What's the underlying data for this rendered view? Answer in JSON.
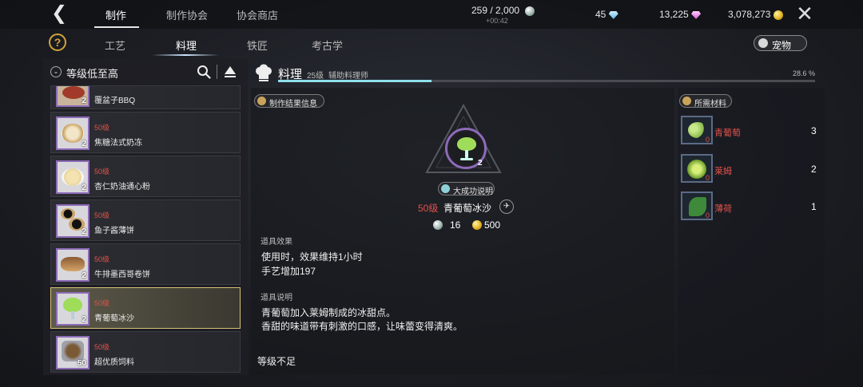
{
  "top_nav": {
    "tabs": [
      "制作",
      "制作协会",
      "协会商店"
    ],
    "active_tab": "制作",
    "stamina": "259 / 2,000",
    "stamina_timer": "+00:42",
    "currencies": [
      {
        "value": "45",
        "icon": "blue-gem-icon"
      },
      {
        "value": "13,225",
        "icon": "pink-gem-icon"
      },
      {
        "value": "3,078,273",
        "icon": "gold-coin-icon"
      }
    ]
  },
  "sub_nav": {
    "tabs": [
      "工艺",
      "料理",
      "铁匠",
      "考古学"
    ],
    "active_tab": "料理",
    "pet_label": "宠物"
  },
  "sort": {
    "label": "等级低至高"
  },
  "recipes": [
    {
      "level": "",
      "name": "覆盆子BBQ",
      "qty": "2"
    },
    {
      "level": "50级",
      "name": "焦糖法式奶冻",
      "qty": "2"
    },
    {
      "level": "50级",
      "name": "杏仁奶油通心粉",
      "qty": "2"
    },
    {
      "level": "50级",
      "name": "鱼子酱薄饼",
      "qty": "2"
    },
    {
      "level": "50级",
      "name": "牛排墨西哥卷饼",
      "qty": "2"
    },
    {
      "level": "50级",
      "name": "青葡萄冰沙",
      "qty": "2"
    },
    {
      "level": "50级",
      "name": "超优质饲料",
      "qty": "50"
    }
  ],
  "selected_recipe_index": 5,
  "profession": {
    "title": "料理",
    "level": "25级",
    "rank": "辅助料理师",
    "progress_percent": 28.6,
    "progress_label": "28.6 %"
  },
  "result": {
    "section_label": "制作结果信息",
    "success_label": "大成功说明",
    "level": "50级",
    "name": "青葡萄冰沙",
    "qty": "2",
    "cost_silver": "16",
    "cost_gold": "500",
    "effect_label": "道具效果",
    "effect_lines": [
      "使用时，效果维持1小时",
      "手艺增加197"
    ],
    "desc_label": "道具说明",
    "desc_lines": [
      "青葡萄加入莱姆制成的冰甜点。",
      "香甜的味道带有刺激的口感，让味蕾变得清爽。"
    ],
    "status": "等级不足"
  },
  "materials": {
    "section_label": "所需材料",
    "items": [
      {
        "name": "青葡萄",
        "owned": "0",
        "required": "3",
        "icon": "green-grapes-icon"
      },
      {
        "name": "莱姆",
        "owned": "0",
        "required": "2",
        "icon": "lime-icon"
      },
      {
        "name": "薄荷",
        "owned": "0",
        "required": "1",
        "icon": "mint-icon"
      }
    ]
  },
  "colors": {
    "accent": "#8fe0ea",
    "level_red": "#e0524a",
    "selected_border": "#d6c27a",
    "rarity_purple": "#8d6bb8"
  }
}
